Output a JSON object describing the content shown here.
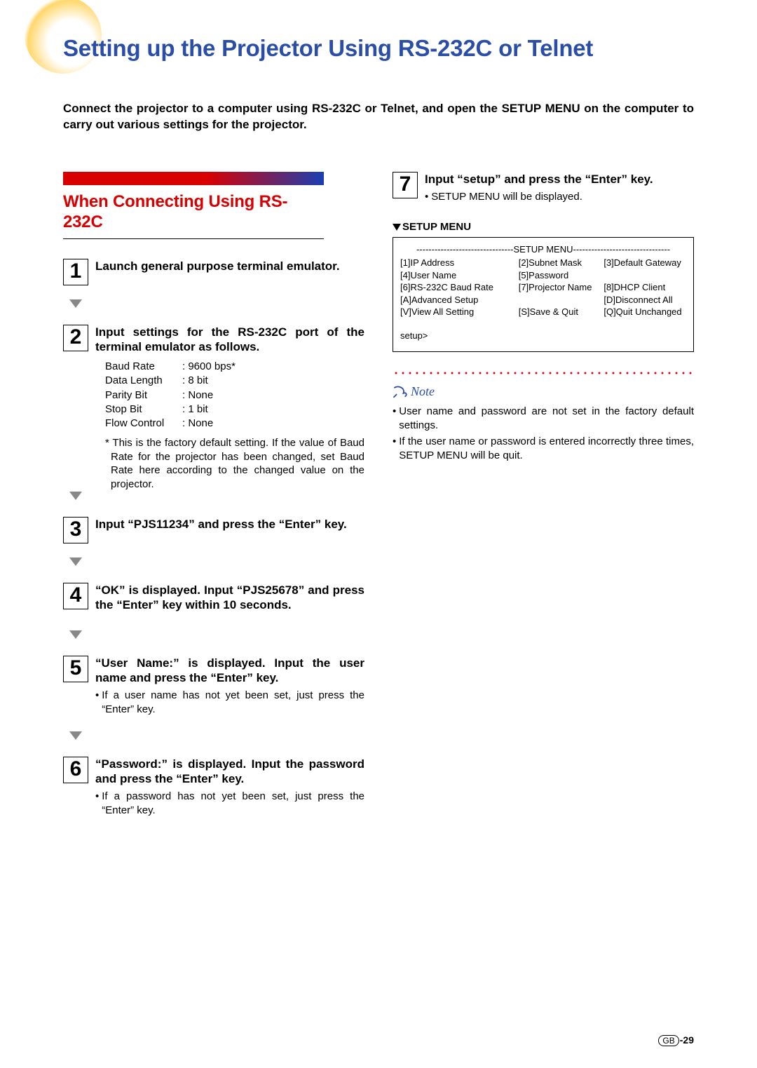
{
  "title": "Setting up the Projector Using RS-232C or Telnet",
  "intro": "Connect the projector to a computer using RS-232C or Telnet, and open the SETUP MENU on the computer to carry out various settings for the projector.",
  "section_title": "When Connecting Using RS-232C",
  "steps": [
    {
      "num": "1",
      "heading": "Launch general purpose terminal emulator."
    },
    {
      "num": "2",
      "heading": "Input settings for the RS-232C port of the terminal emulator as follows.",
      "settings": [
        {
          "label": "Baud Rate",
          "val": "9600 bps*"
        },
        {
          "label": "Data Length",
          "val": "8 bit"
        },
        {
          "label": "Parity Bit",
          "val": "None"
        },
        {
          "label": "Stop Bit",
          "val": "1 bit"
        },
        {
          "label": "Flow Control",
          "val": "None"
        }
      ],
      "footnote": "* This is the factory default setting. If the value of Baud Rate for the projector has been changed, set Baud Rate here according to the changed value on the projector."
    },
    {
      "num": "3",
      "heading": "Input “PJS11234” and press the “Enter” key."
    },
    {
      "num": "4",
      "heading": "“OK” is displayed. Input “PJS25678” and press the “Enter” key within 10 seconds."
    },
    {
      "num": "5",
      "heading": "“User Name:” is displayed. Input the user name and press the “Enter” key.",
      "bullets": [
        "If a user name has not yet been set, just press the “Enter” key."
      ]
    },
    {
      "num": "6",
      "heading": "“Password:” is displayed. Input the password and press the “Enter” key.",
      "bullets": [
        "If a password has not yet been set, just press the “Enter” key."
      ]
    }
  ],
  "right_step": {
    "num": "7",
    "heading": "Input “setup” and press the “Enter” key.",
    "bullets": [
      "SETUP MENU will be displayed."
    ]
  },
  "setup_menu_label": "SETUP MENU",
  "setup_menu": {
    "header": "--------------------------------SETUP MENU--------------------------------",
    "rows": [
      [
        "[1]IP Address",
        "[2]Subnet Mask",
        "[3]Default Gateway"
      ],
      [
        "[4]User Name",
        "[5]Password",
        ""
      ],
      [
        "[6]RS-232C Baud Rate",
        "[7]Projector Name",
        "[8]DHCP Client"
      ],
      [
        "[A]Advanced Setup",
        "",
        "[D]Disconnect All"
      ],
      [
        "[V]View All Setting",
        "[S]Save & Quit",
        "[Q]Quit Unchanged"
      ]
    ],
    "prompt": "setup>"
  },
  "note_label": "Note",
  "note_bullets": [
    "User name and password are not set in the factory default settings.",
    "If the user name or password is entered incorrectly three times, SETUP MENU will be quit."
  ],
  "page_region": "GB",
  "page_number": "-29"
}
